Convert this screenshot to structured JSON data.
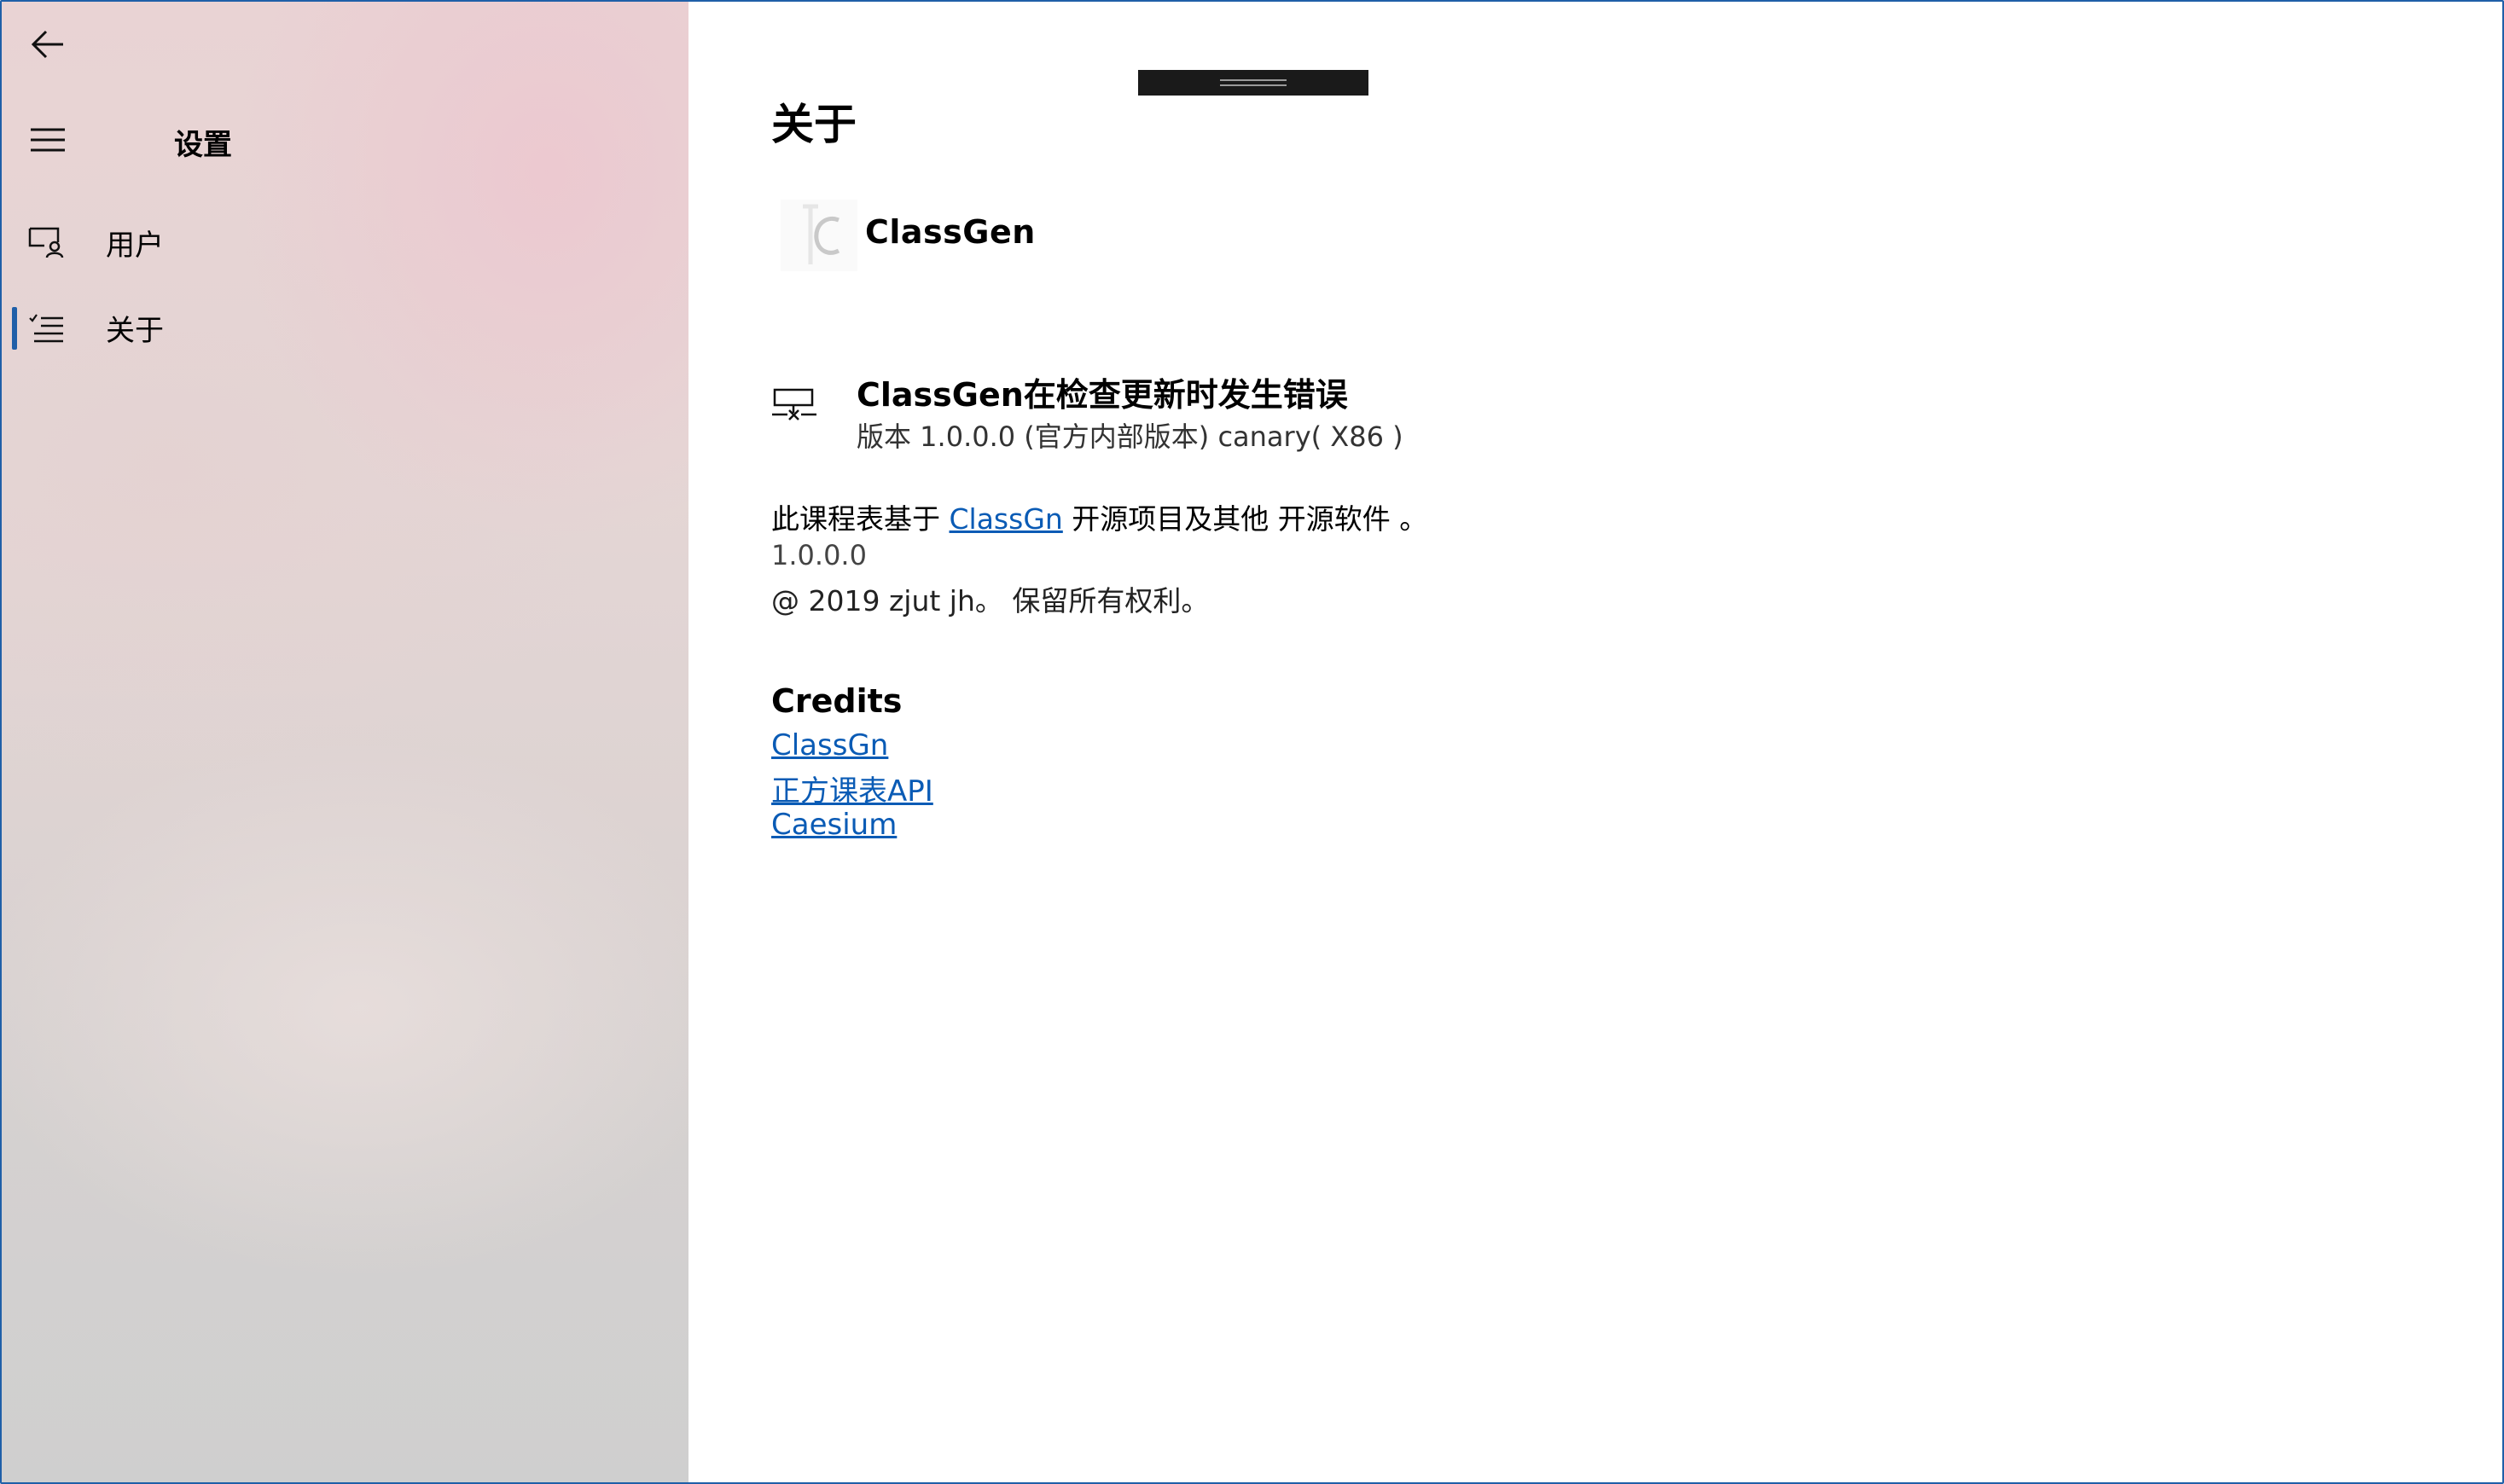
{
  "sidebar": {
    "title": "设置",
    "items": [
      {
        "label": "用户",
        "icon": "user-settings-icon"
      },
      {
        "label": "关于",
        "icon": "checklist-icon",
        "selected": true
      }
    ]
  },
  "main": {
    "page_title": "关于",
    "app_name": "ClassGen",
    "update": {
      "title": "ClassGen在检查更新时发生错误",
      "version_line": "版本 1.0.0.0 (官方内部版本) canary( X86 )"
    },
    "description": {
      "prefix": "此课程表基于 ",
      "link": "ClassGn",
      "suffix": " 开源项目及其他 开源软件 。"
    },
    "version": "1.0.0.0",
    "copyright": "@ 2019 zjut jh。 保留所有权利。",
    "credits_title": "Credits",
    "credits": [
      "ClassGn",
      "正方课表API",
      "Caesium"
    ]
  },
  "colors": {
    "accent": "#1f5fa8",
    "link": "#0a5bb5"
  }
}
